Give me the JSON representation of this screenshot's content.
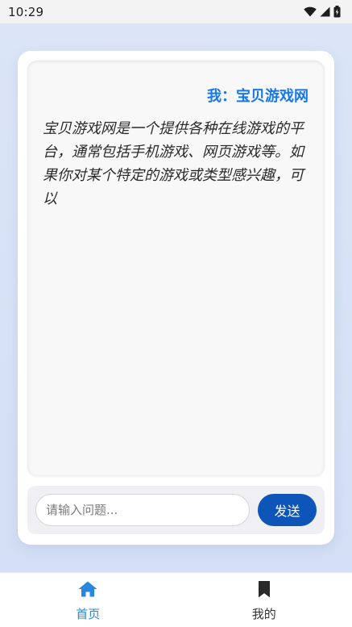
{
  "status_bar": {
    "time": "10:29",
    "icons": [
      "wifi-icon",
      "signal-icon",
      "battery-icon"
    ]
  },
  "chat": {
    "user_label": "我：宝贝游戏网",
    "answer": "宝贝游戏网是一个提供各种在线游戏的平台，通常包括手机游戏、网页游戏等。如果你对某个特定的游戏或类型感兴趣，可以"
  },
  "input": {
    "placeholder": "请输入问题...",
    "value": ""
  },
  "send_button": {
    "label": "发送"
  },
  "bottom_nav": {
    "items": [
      {
        "label": "首页",
        "icon": "home-icon",
        "active": true
      },
      {
        "label": "我的",
        "icon": "bookmark-icon",
        "active": false
      }
    ]
  },
  "colors": {
    "accent": "#1678ec",
    "send_button": "#0d55b8",
    "nav_active": "#2a88dc",
    "background": "#d8e2f6"
  }
}
